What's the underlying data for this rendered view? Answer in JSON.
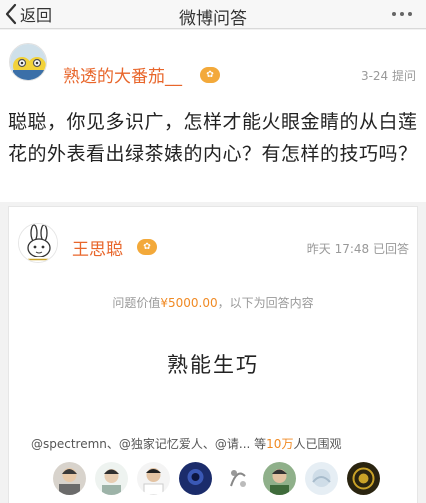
{
  "nav": {
    "back_label": "返回",
    "title": "微博问答"
  },
  "question": {
    "asker_name": "熟透的大番茄__",
    "meta": "3-24 提问",
    "text": "聪聪，你见多识广，怎样才能火眼金睛的从白莲花的外表看出绿茶婊的内心？有怎样的技巧吗？"
  },
  "answer": {
    "answerer_name": "王思聪",
    "meta": "昨天 17:48 已回答",
    "price_prefix": "问题价值",
    "price": "¥5000.00",
    "price_suffix": "，以下为回答内容",
    "text": "熟能生巧",
    "viewers_prefix": "@spectremn、@独家记忆爱人、@请... 等",
    "viewers_count": "10万",
    "viewers_suffix": "人已围观"
  },
  "colors": {
    "accent_orange": "#e8662b",
    "price_orange": "#f08a24",
    "badge": "#f3a93a"
  },
  "icons": {
    "back": "chevron-left-icon",
    "more": "more-dots-icon",
    "badge": "verified-badge-icon"
  }
}
